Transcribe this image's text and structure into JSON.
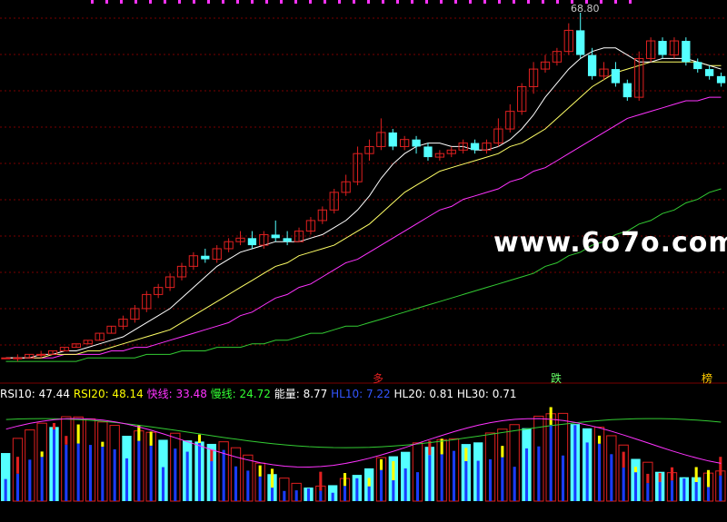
{
  "colors": {
    "background": "#000000",
    "grid": "#7a0000",
    "up": "#e02020",
    "down": "#54ffff",
    "ma_white": "#ffffff",
    "ma_yellow": "#ffff66",
    "ma_magenta": "#ff33ff",
    "ma_green": "#33cc33",
    "ind_cyan": "#54ffff",
    "ind_red": "#e02020",
    "ind_yellow": "#ffff00",
    "ind_blue": "#1a3cff",
    "ind_magenta": "#ff33ff",
    "ind_green": "#33cc33"
  },
  "price_label": "68.80",
  "watermark": "www.6o7o.com",
  "signals": [
    {
      "text": "多",
      "color": "#e02020"
    },
    {
      "text": "跌",
      "color": "#66ff66"
    },
    {
      "text": "榜",
      "color": "#ffcc00"
    }
  ],
  "legend": [
    {
      "label": "RSI10: 47.44",
      "color": "#ffffff"
    },
    {
      "label": "RSI20: 48.14",
      "color": "#ffff00"
    },
    {
      "label": "快线: 33.48",
      "color": "#ff33ff"
    },
    {
      "label": "慢线: 24.72",
      "color": "#33ff33"
    },
    {
      "label": "能量: 8.77",
      "color": "#ffffff"
    },
    {
      "label": "HL10: 7.22",
      "color": "#3355ff"
    },
    {
      "label": "HL20: 0.81",
      "color": "#ffffff"
    },
    {
      "label": "HL30: 0.71",
      "color": "#ffffff"
    }
  ],
  "chart_data": {
    "type": "candlestick",
    "candles": [
      [
        2,
        2,
        2,
        2
      ],
      [
        2,
        2,
        3,
        1
      ],
      [
        2,
        3,
        3,
        2
      ],
      [
        3,
        3,
        4,
        2
      ],
      [
        3,
        4,
        4,
        3
      ],
      [
        4,
        5,
        5,
        4
      ],
      [
        5,
        6,
        6,
        5
      ],
      [
        6,
        7,
        7,
        6
      ],
      [
        7,
        9,
        9,
        7
      ],
      [
        9,
        11,
        11,
        9
      ],
      [
        11,
        13,
        14,
        10
      ],
      [
        13,
        16,
        17,
        12
      ],
      [
        16,
        20,
        21,
        15
      ],
      [
        20,
        22,
        23,
        19
      ],
      [
        22,
        25,
        26,
        21
      ],
      [
        25,
        28,
        29,
        24
      ],
      [
        28,
        31,
        32,
        27
      ],
      [
        31,
        30,
        33,
        29
      ],
      [
        30,
        33,
        34,
        29
      ],
      [
        33,
        35,
        36,
        32
      ],
      [
        35,
        36,
        38,
        34
      ],
      [
        36,
        34,
        38,
        33
      ],
      [
        34,
        37,
        38,
        33
      ],
      [
        37,
        36,
        41,
        35
      ],
      [
        36,
        35,
        38,
        34
      ],
      [
        35,
        38,
        39,
        35
      ],
      [
        38,
        41,
        42,
        37
      ],
      [
        41,
        44,
        45,
        40
      ],
      [
        44,
        49,
        50,
        43
      ],
      [
        49,
        52,
        54,
        48
      ],
      [
        52,
        60,
        62,
        51
      ],
      [
        60,
        62,
        64,
        58
      ],
      [
        62,
        66,
        70,
        61
      ],
      [
        66,
        62,
        67,
        61
      ],
      [
        62,
        64,
        65,
        61
      ],
      [
        64,
        62,
        65,
        60
      ],
      [
        62,
        59,
        63,
        58
      ],
      [
        59,
        60,
        61,
        58
      ],
      [
        60,
        61,
        62,
        59
      ],
      [
        61,
        63,
        64,
        60
      ],
      [
        63,
        61,
        64,
        60
      ],
      [
        61,
        63,
        64,
        60
      ],
      [
        63,
        67,
        70,
        62
      ],
      [
        67,
        72,
        74,
        66
      ],
      [
        72,
        79,
        80,
        71
      ],
      [
        79,
        84,
        86,
        77
      ],
      [
        84,
        86,
        88,
        83
      ],
      [
        86,
        89,
        90,
        85
      ],
      [
        89,
        95,
        97,
        88
      ],
      [
        95,
        88,
        100,
        87
      ],
      [
        88,
        82,
        90,
        81
      ],
      [
        82,
        84,
        86,
        81
      ],
      [
        84,
        80,
        86,
        79
      ],
      [
        80,
        76,
        81,
        75
      ],
      [
        76,
        87,
        89,
        75
      ],
      [
        87,
        92,
        93,
        86
      ],
      [
        92,
        88,
        93,
        87
      ],
      [
        88,
        92,
        93,
        87
      ],
      [
        92,
        86,
        93,
        85
      ],
      [
        86,
        84,
        87,
        83
      ],
      [
        84,
        82,
        85,
        81
      ],
      [
        82,
        80,
        83,
        79
      ]
    ],
    "ma_white": [
      2,
      2,
      2,
      3,
      3,
      4,
      4,
      5,
      6,
      7,
      8,
      10,
      12,
      14,
      16,
      19,
      22,
      25,
      28,
      30,
      32,
      33,
      34,
      35,
      35,
      35,
      36,
      37,
      39,
      41,
      44,
      48,
      53,
      57,
      60,
      62,
      63,
      63,
      62,
      62,
      61,
      61,
      62,
      64,
      67,
      71,
      76,
      80,
      84,
      87,
      89,
      90,
      90,
      88,
      86,
      86,
      87,
      87,
      87,
      86,
      85,
      84
    ],
    "ma_yellow": [
      2,
      2,
      2,
      2,
      3,
      3,
      3,
      4,
      4,
      5,
      6,
      7,
      8,
      9,
      10,
      12,
      14,
      16,
      18,
      20,
      22,
      24,
      26,
      28,
      29,
      31,
      32,
      33,
      34,
      36,
      38,
      40,
      43,
      46,
      49,
      51,
      53,
      55,
      56,
      57,
      58,
      59,
      60,
      62,
      63,
      65,
      67,
      70,
      73,
      76,
      79,
      81,
      83,
      84,
      85,
      86,
      86,
      86,
      86,
      86,
      85,
      85
    ],
    "ma_magenta": [
      2,
      2,
      2,
      2,
      2,
      3,
      3,
      3,
      3,
      4,
      4,
      5,
      5,
      6,
      7,
      8,
      9,
      10,
      11,
      12,
      14,
      15,
      17,
      19,
      20,
      22,
      23,
      25,
      27,
      29,
      30,
      32,
      34,
      36,
      38,
      40,
      42,
      44,
      45,
      47,
      48,
      49,
      50,
      52,
      53,
      55,
      56,
      58,
      60,
      62,
      64,
      66,
      68,
      70,
      71,
      72,
      73,
      74,
      75,
      75,
      76,
      76
    ],
    "ma_green": [
      1,
      1,
      1,
      1,
      1,
      1,
      1,
      2,
      2,
      2,
      2,
      2,
      3,
      3,
      3,
      4,
      4,
      4,
      5,
      5,
      5,
      6,
      6,
      7,
      7,
      8,
      9,
      9,
      10,
      11,
      11,
      12,
      13,
      14,
      15,
      16,
      17,
      18,
      19,
      20,
      21,
      22,
      23,
      24,
      25,
      26,
      28,
      29,
      31,
      32,
      34,
      35,
      37,
      38,
      40,
      41,
      43,
      44,
      46,
      47,
      49,
      50
    ],
    "ylim": [
      0,
      100
    ]
  }
}
